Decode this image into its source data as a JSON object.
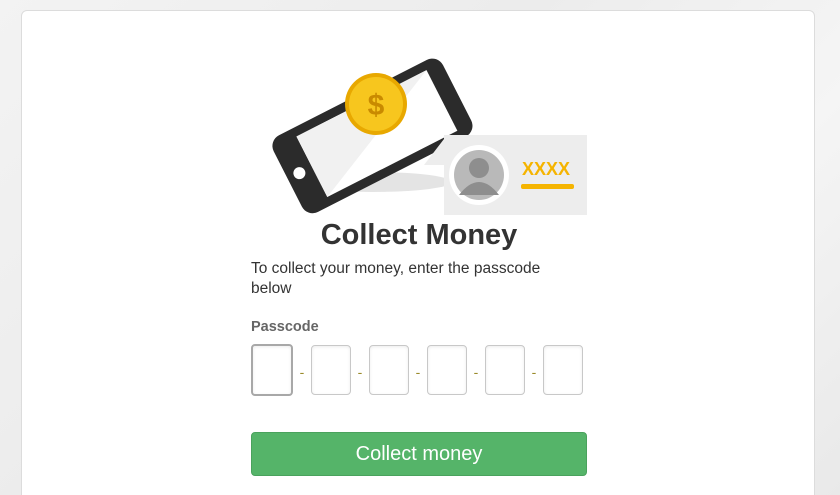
{
  "illustration": {
    "currency_symbol": "$",
    "masked_code": "XXXX",
    "colors": {
      "phone_body": "#2b2b2b",
      "coin": "#f5c518",
      "accent": "#f5b400",
      "card_bg": "#ededed"
    }
  },
  "page": {
    "title": "Collect Money",
    "subtitle": "To collect your money, enter the passcode below"
  },
  "passcode": {
    "label": "Passcode",
    "separator": "-",
    "digits": [
      "",
      "",
      "",
      "",
      "",
      ""
    ]
  },
  "actions": {
    "collect_label": "Collect money",
    "button_color": "#55b469"
  }
}
